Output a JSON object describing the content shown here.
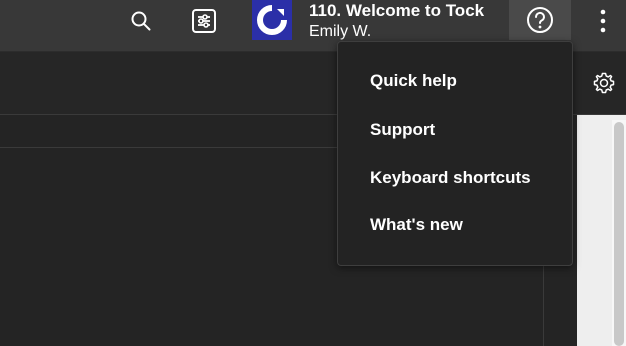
{
  "topbar": {
    "search_icon": "search-icon",
    "filter_icon": "sliders-icon",
    "venue": {
      "logo_icon": "tock-logo",
      "name": "110. Welcome to Tock",
      "user": "Emily W."
    },
    "help_icon": "question-circle-icon",
    "more_icon": "vertical-dots-icon"
  },
  "help_menu": {
    "items": [
      {
        "label": "Quick help"
      },
      {
        "label": "Support"
      },
      {
        "label": "Keyboard shortcuts"
      },
      {
        "label": "What's new"
      }
    ]
  },
  "subheader": {
    "settings_icon": "gear-icon"
  },
  "colors": {
    "topbar_bg": "#383838",
    "page_bg": "#242424",
    "logo_bg": "#2b2fa8",
    "help_active_bg": "#4a4a4a",
    "menu_bg": "#232323",
    "text": "#ffffff"
  }
}
